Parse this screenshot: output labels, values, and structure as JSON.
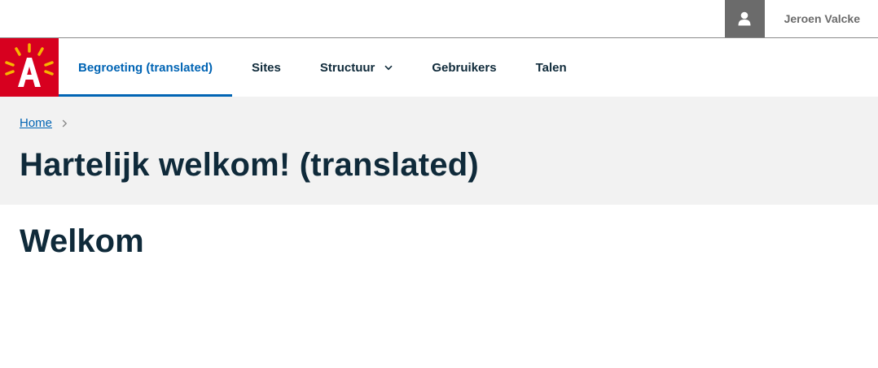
{
  "user": {
    "name": "Jeroen Valcke",
    "icon": "user-icon"
  },
  "logo": {
    "letter": "A",
    "icon": "antwerp-logo",
    "color": "#d7001f"
  },
  "nav": {
    "items": [
      {
        "label": "Begroeting (translated)",
        "active": true
      },
      {
        "label": "Sites",
        "active": false
      },
      {
        "label": "Structuur",
        "active": false,
        "has_dropdown": true
      },
      {
        "label": "Gebruikers",
        "active": false
      },
      {
        "label": "Talen",
        "active": false
      }
    ]
  },
  "breadcrumb": {
    "home": "Home"
  },
  "page": {
    "title": "Hartelijk welkom! (translated)",
    "section_title": "Welkom"
  },
  "colors": {
    "accent": "#0064b4",
    "text": "#0f2a3a",
    "band": "#f2f2f2",
    "muted": "#6b6b6b"
  }
}
